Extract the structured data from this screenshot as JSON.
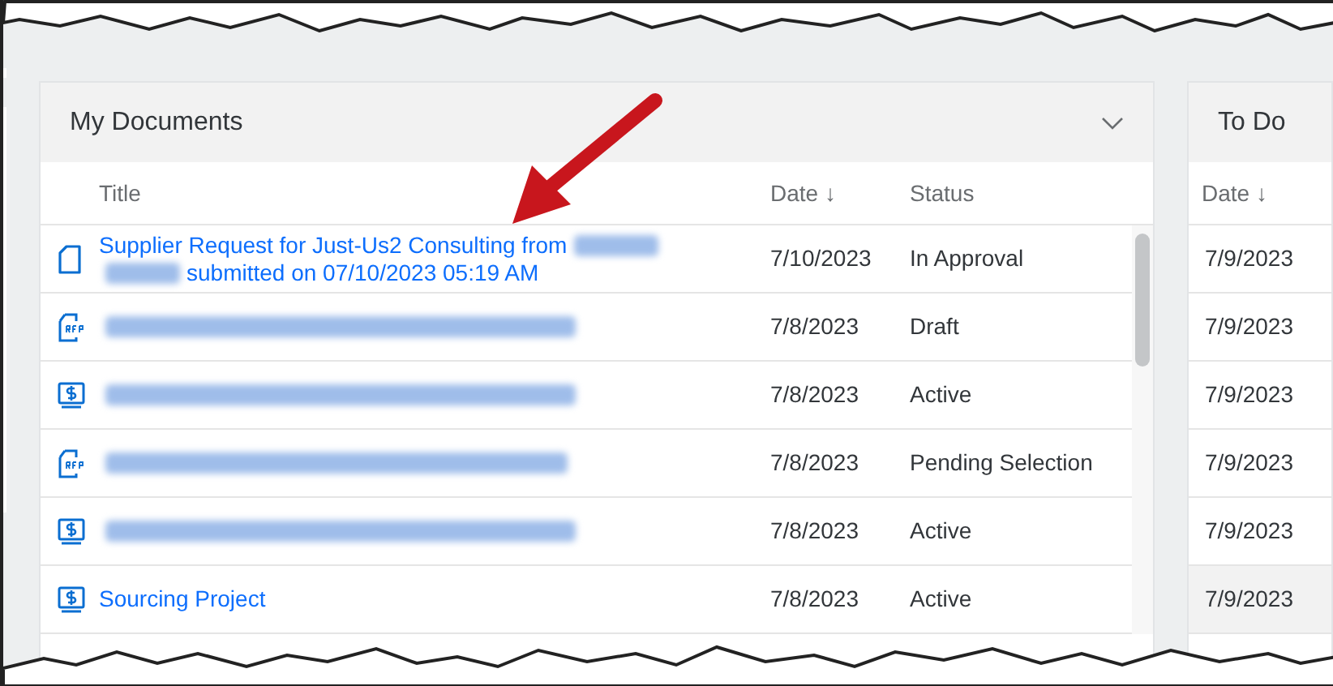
{
  "my_documents": {
    "title": "My Documents",
    "columns": [
      {
        "label": "Title"
      },
      {
        "label": "Date",
        "sort_mark": "↓"
      },
      {
        "label": "Status"
      }
    ],
    "rows": [
      {
        "kind": "document",
        "title": [
          {
            "kind": "text",
            "text": "Supplier Request for Just-Us2 Consulting from"
          },
          {
            "kind": "redacted"
          },
          {
            "kind": "break"
          },
          {
            "kind": "redacted"
          },
          {
            "kind": "text",
            "text": "submitted on 07/10/2023 05:19 AM"
          }
        ],
        "date": "7/10/2023",
        "status": "In Approval"
      },
      {
        "kind": "rfp",
        "title": [
          {
            "kind": "redacted"
          }
        ],
        "date": "7/8/2023",
        "status": "Draft"
      },
      {
        "kind": "project",
        "title": [
          {
            "kind": "redacted"
          }
        ],
        "date": "7/8/2023",
        "status": "Active"
      },
      {
        "kind": "rfp",
        "title": [
          {
            "kind": "redacted"
          }
        ],
        "date": "7/8/2023",
        "status": "Pending Selection"
      },
      {
        "kind": "project",
        "title": [
          {
            "kind": "redacted"
          }
        ],
        "date": "7/8/2023",
        "status": "Active"
      },
      {
        "kind": "project",
        "title": [
          {
            "kind": "text",
            "text": "Sourcing Project"
          }
        ],
        "date": "7/8/2023",
        "status": "Active"
      }
    ]
  },
  "to_do": {
    "title": "To Do",
    "columns": [
      {
        "label": "Date",
        "sort_mark": "↓"
      }
    ],
    "rows": [
      {
        "date": "7/9/2023",
        "selected": false
      },
      {
        "date": "7/9/2023",
        "selected": false
      },
      {
        "date": "7/9/2023",
        "selected": false
      },
      {
        "date": "7/9/2023",
        "selected": false
      },
      {
        "date": "7/9/2023",
        "selected": false
      },
      {
        "date": "7/9/2023",
        "selected": true
      }
    ]
  }
}
